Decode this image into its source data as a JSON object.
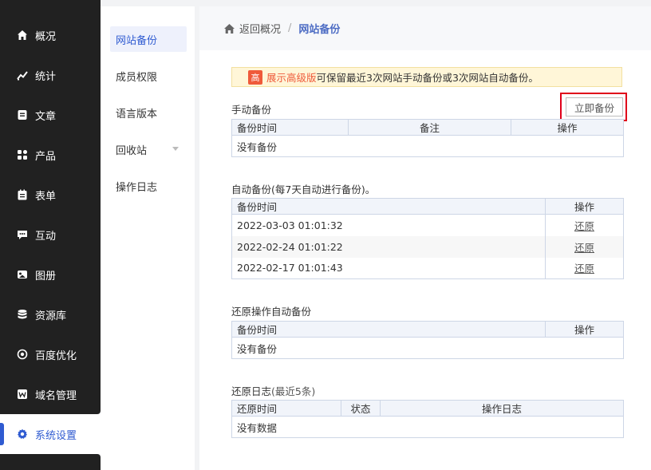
{
  "nav": {
    "items": [
      {
        "label": "概况",
        "icon": "home-icon"
      },
      {
        "label": "统计",
        "icon": "chart-icon"
      },
      {
        "label": "文章",
        "icon": "article-icon"
      },
      {
        "label": "产品",
        "icon": "grid-icon"
      },
      {
        "label": "表单",
        "icon": "form-icon"
      },
      {
        "label": "互动",
        "icon": "chat-icon"
      },
      {
        "label": "图册",
        "icon": "album-icon"
      },
      {
        "label": "资源库",
        "icon": "database-icon"
      },
      {
        "label": "百度优化",
        "icon": "seo-icon"
      },
      {
        "label": "域名管理",
        "icon": "domain-icon"
      },
      {
        "label": "系统设置",
        "icon": "gear-icon"
      }
    ]
  },
  "submenu": {
    "items": [
      {
        "label": "网站备份"
      },
      {
        "label": "成员权限"
      },
      {
        "label": "语言版本"
      },
      {
        "label": "回收站"
      },
      {
        "label": "操作日志"
      }
    ]
  },
  "breadcrumb": {
    "back": "返回概况",
    "sep": "/",
    "current": "网站备份"
  },
  "notice": {
    "tag": "高",
    "highlight": "展示高级版",
    "text": "可保留最近3次网站手动备份或3次网站自动备份。"
  },
  "manual": {
    "title": "手动备份",
    "button": "立即备份",
    "headers": [
      "备份时间",
      "备注",
      "操作"
    ],
    "empty": "没有备份"
  },
  "auto": {
    "title": "自动备份(每7天自动进行备份)。",
    "headers": [
      "备份时间",
      "操作"
    ],
    "rows": [
      {
        "time": "2022-03-03 01:01:32",
        "action": "还原"
      },
      {
        "time": "2022-02-24 01:01:22",
        "action": "还原"
      },
      {
        "time": "2022-02-17 01:01:43",
        "action": "还原"
      }
    ]
  },
  "restore_auto": {
    "title": "还原操作自动备份",
    "headers": [
      "备份时间",
      "操作"
    ],
    "empty": "没有备份"
  },
  "restore_log": {
    "title": "还原日志",
    "title_suffix": "(最近5条)",
    "headers": [
      "还原时间",
      "状态",
      "操作日志"
    ],
    "empty": "没有数据"
  }
}
